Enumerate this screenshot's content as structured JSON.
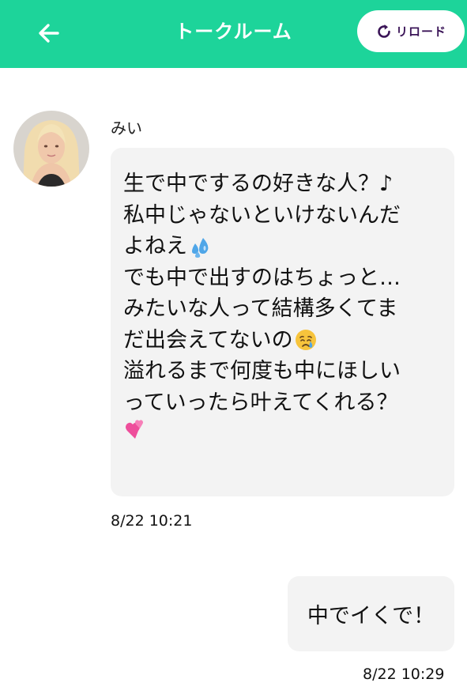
{
  "header": {
    "title": "トークルーム",
    "reload_label": "リロード",
    "back_icon": "arrow-left-icon",
    "reload_icon": "refresh-icon",
    "color": "#1dd49a"
  },
  "messages": [
    {
      "sender": "みい",
      "direction": "incoming",
      "lines": [
        "生で中でするの好きな人？♪",
        "私中じゃないといけないんだ",
        "よねえ",
        "でも中で出すのはちょっと…",
        "みたいな人って結構多くてま",
        "だ出会えてないの",
        "溢れるまで何度も中にほしい",
        "っていったら叶えてくれる？",
        ""
      ],
      "time": "8/22 10:21"
    },
    {
      "direction": "outgoing",
      "text": "中でイくで！",
      "time": "8/22 10:29"
    }
  ]
}
